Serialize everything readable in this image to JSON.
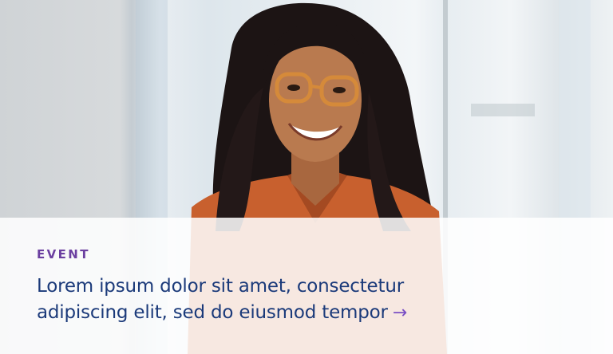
{
  "card": {
    "eyebrow": "EVENT",
    "headline_line1": "Lorem ipsum dolor sit amet, consectetur",
    "headline_line2": "adipiscing elit, sed do eiusmod tempor",
    "arrow_icon": "arrow-right-icon",
    "arrow_glyph": "→"
  },
  "colors": {
    "eyebrow": "#6b3fa0",
    "headline": "#1b3a7a",
    "arrow": "#7a4fc4"
  }
}
